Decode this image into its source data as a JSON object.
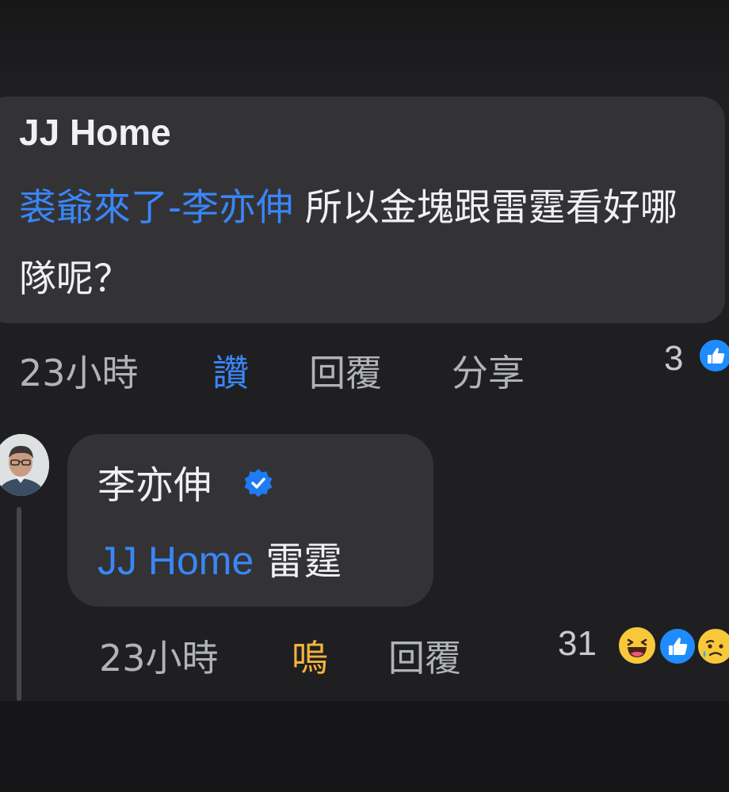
{
  "comment": {
    "author": "JJ Home",
    "mention": "裘爺來了-李亦伸",
    "text": " 所以金塊跟雷霆看好哪隊呢？",
    "time": "23小時",
    "like_label": "讚",
    "reply_label": "回覆",
    "share_label": "分享",
    "reaction_count": "3",
    "reactions": [
      "like-icon"
    ]
  },
  "reply": {
    "author": "李亦伸",
    "verified": true,
    "mention": "JJ Home",
    "text": " 雷霆",
    "time": "23小時",
    "reaction_label": "嗚",
    "reply_label": "回覆",
    "reaction_count": "31",
    "reactions": [
      "haha-icon",
      "like-icon",
      "sad-icon"
    ]
  },
  "colors": {
    "background": "#1f1f22",
    "bubble": "#333336",
    "mention": "#3a86f7",
    "liked": "#3a86f7",
    "sad_reaction": "#f2b33d",
    "meta_text": "#b0b3b8"
  }
}
